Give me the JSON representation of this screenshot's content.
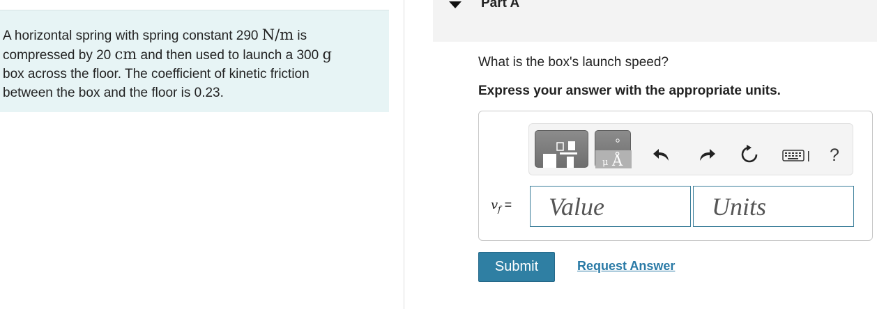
{
  "problem": {
    "line1_pre": "A horizontal spring with spring constant 290 ",
    "line1_unit": "N/m",
    "line1_post": " is",
    "line2_pre": "compressed by 20 ",
    "line2_unit1": "cm",
    "line2_mid": " and then used to launch a 300 ",
    "line2_unit2": "g",
    "line3": "box across the floor. The coefficient of kinetic friction",
    "line4": "between the box and the floor is 0.23."
  },
  "part": {
    "title": "Part A"
  },
  "question": "What is the box's launch speed?",
  "instruction": "Express your answer with the appropriate units.",
  "toolbar": {
    "templates_icon": "fraction-template-icon",
    "units_icon": "units-angstrom-icon",
    "undo_icon": "undo-icon",
    "redo_icon": "redo-icon",
    "reset_icon": "reset-icon",
    "keyboard_icon": "keyboard-icon",
    "help_label": "?"
  },
  "answer": {
    "variable": "v",
    "subscript": "f",
    "equals": " =",
    "value_placeholder": "Value",
    "units_placeholder": "Units"
  },
  "actions": {
    "submit_label": "Submit",
    "request_label": "Request Answer"
  },
  "colors": {
    "problem_bg": "#e7f4f5",
    "submit_bg": "#2f7fa3",
    "link": "#2a7aa6",
    "field_border": "#3b7e9a"
  }
}
